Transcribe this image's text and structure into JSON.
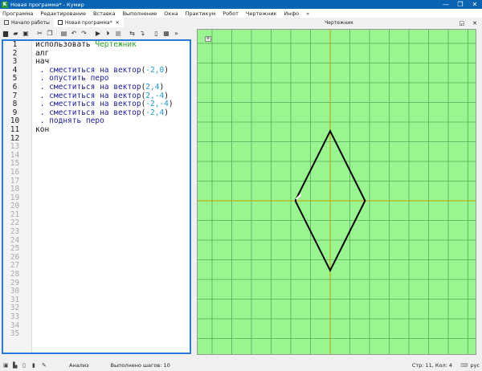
{
  "window": {
    "title": "Новая программа* - Кумир",
    "icon": "K",
    "buttons": [
      "—",
      "❐",
      "✕"
    ]
  },
  "menu": [
    "Программа",
    "Редактирование",
    "Вставка",
    "Выполнение",
    "Окна",
    "Практикум",
    "Робот",
    "Чертежник",
    "Инфо",
    "»"
  ],
  "tabs": [
    {
      "label": "Начало работы",
      "icon": "page-icon"
    },
    {
      "label": "Новая программа*",
      "icon": "program-icon",
      "close": "✕"
    }
  ],
  "toolbar": [
    "new-icon",
    "open-icon",
    "save-icon",
    "cut-icon",
    "copy-icon",
    "paste-icon",
    "undo-icon",
    "redo-icon",
    "run-icon",
    "step-icon",
    "stop-icon",
    "step-in-icon",
    "step-out-icon",
    "panel-icon",
    "grid-icon",
    "more-icon"
  ],
  "editor": {
    "line_count": 35,
    "current_line": 12,
    "lines": [
      [
        {
          "t": "использовать ",
          "c": "kw"
        },
        {
          "t": "Чертежник",
          "c": "mod"
        }
      ],
      [
        {
          "t": "алг",
          "c": "kw"
        }
      ],
      [
        {
          "t": "нач",
          "c": "kw"
        }
      ],
      [
        {
          "t": " . сместиться на вектор",
          "c": "fn"
        },
        {
          "t": "(",
          "c": "kw"
        },
        {
          "t": "-2,0",
          "c": "num"
        },
        {
          "t": ")",
          "c": "kw"
        }
      ],
      [
        {
          "t": " . опустить перо",
          "c": "fn"
        }
      ],
      [
        {
          "t": " . сместиться на вектор",
          "c": "fn"
        },
        {
          "t": "(",
          "c": "kw"
        },
        {
          "t": "2,4",
          "c": "num"
        },
        {
          "t": ")",
          "c": "kw"
        }
      ],
      [
        {
          "t": " . сместиться на вектор",
          "c": "fn"
        },
        {
          "t": "(",
          "c": "kw"
        },
        {
          "t": "2,-4",
          "c": "num"
        },
        {
          "t": ")",
          "c": "kw"
        }
      ],
      [
        {
          "t": " . сместиться на вектор",
          "c": "fn"
        },
        {
          "t": "(",
          "c": "kw"
        },
        {
          "t": "-2,-4",
          "c": "num"
        },
        {
          "t": ")",
          "c": "kw"
        }
      ],
      [
        {
          "t": " . сместиться на вектор",
          "c": "fn"
        },
        {
          "t": "(",
          "c": "kw"
        },
        {
          "t": "-2,4",
          "c": "num"
        },
        {
          "t": ")",
          "c": "kw"
        }
      ],
      [
        {
          "t": " . поднять перо",
          "c": "fn"
        }
      ],
      [
        {
          "t": "кон",
          "c": "kw"
        }
      ]
    ]
  },
  "drawer": {
    "title": "Чертежник",
    "buttons": [
      "◲",
      "✕"
    ],
    "background": "#99f58f",
    "grid_color": "#5aa85a",
    "axis_color": "#c8a000",
    "line_color": "#000000",
    "path": [
      [
        -2,
        0
      ],
      [
        0,
        4
      ],
      [
        2,
        0
      ],
      [
        0,
        -4
      ],
      [
        -2,
        0
      ]
    ]
  },
  "status": {
    "icons": [
      "panel-icon",
      "save-icon",
      "copy-icon",
      "delete-icon",
      "pen-icon"
    ],
    "mode": "Анализ",
    "steps": "Выполнено шагов: 10",
    "position": "Стр: 11, Кол: 4",
    "lang": "рус"
  }
}
